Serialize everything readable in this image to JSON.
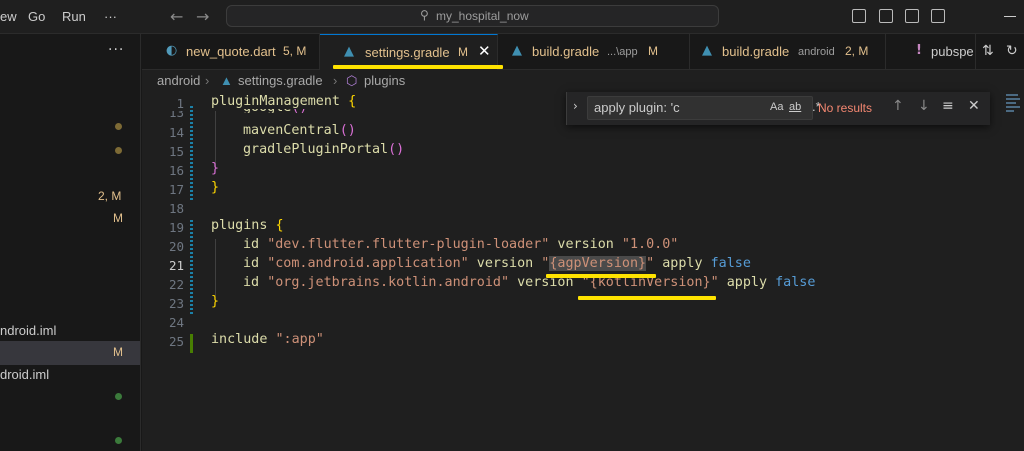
{
  "menu": {
    "items": [
      "ew",
      "Go",
      "Run",
      "···"
    ]
  },
  "command_center": {
    "text": "my_hospital_now"
  },
  "sidebar": {
    "more": "···",
    "badges": [
      "2, M",
      "M",
      "M"
    ],
    "files": [
      "ndroid.iml",
      "droid.iml"
    ]
  },
  "tabs": [
    {
      "name": "new_quote.dart",
      "desc": "",
      "status": "5, M",
      "icon_color": "#519aba"
    },
    {
      "name": "settings.gradle",
      "desc": "",
      "status": "M",
      "icon_color": "#02303a",
      "active": true
    },
    {
      "name": "build.gradle",
      "desc": "...\\app",
      "status": "M"
    },
    {
      "name": "build.gradle",
      "desc": "android",
      "status": "2, M"
    },
    {
      "name": "pubspe",
      "desc": "",
      "status": ""
    }
  ],
  "breadcrumb": {
    "root": "android",
    "file": "settings.gradle",
    "symbol": "plugins"
  },
  "find": {
    "query": "apply plugin: 'c",
    "options": [
      "Aa",
      "ab",
      ".*"
    ],
    "results": "No results"
  },
  "lines": [
    {
      "n": "1",
      "text": "pluginManagement {"
    },
    {
      "n": "13",
      "text": "google()"
    },
    {
      "n": "14",
      "text": "mavenCentral()"
    },
    {
      "n": "15",
      "text": "gradlePluginPortal()"
    },
    {
      "n": "16",
      "text": "}"
    },
    {
      "n": "17",
      "text": "}"
    },
    {
      "n": "18",
      "text": ""
    },
    {
      "n": "19",
      "text": "plugins {"
    },
    {
      "n": "20",
      "text": "id \"dev.flutter.flutter-plugin-loader\" version \"1.0.0\""
    },
    {
      "n": "21",
      "text": "id \"com.android.application\" version \"{agpVersion}\" apply false"
    },
    {
      "n": "22",
      "text": "id \"org.jetbrains.kotlin.android\" version \"{kotlinVersion}\" apply false"
    },
    {
      "n": "23",
      "text": "}"
    },
    {
      "n": "24",
      "text": ""
    },
    {
      "n": "25",
      "text": "include \":app\""
    }
  ],
  "code": {
    "l1_kw": "pluginManagement",
    "l1_br": "{",
    "l13_fn": "google",
    "l13_p": "()",
    "l14_fn": "mavenCentral",
    "l14_p": "()",
    "l15_fn": "gradlePluginPortal",
    "l15_p": "()",
    "l16_br": "}",
    "l17_br": "}",
    "l19_kw": "plugins",
    "l19_br": "{",
    "id": "id",
    "version": "version",
    "apply": "apply",
    "false": "false",
    "l20_s1": "\"dev.flutter.flutter-plugin-loader\"",
    "l20_s2": "\"1.0.0\"",
    "l21_s1": "\"com.android.application\"",
    "l21_q1": "\"",
    "l21_v": "{agpVersion}",
    "l21_q2": "\"",
    "l22_s1": "\"org.jetbrains.kotlin.android\"",
    "l22_q1": "\"",
    "l22_v": "{kotlinVersion}",
    "l22_q2": "\"",
    "l23_br": "}",
    "l25_kw": "include",
    "l25_s": "\":app\""
  },
  "colors": {
    "accent": "#0078d4",
    "modified": "#e2c08d",
    "annotation": "#ffe300"
  }
}
